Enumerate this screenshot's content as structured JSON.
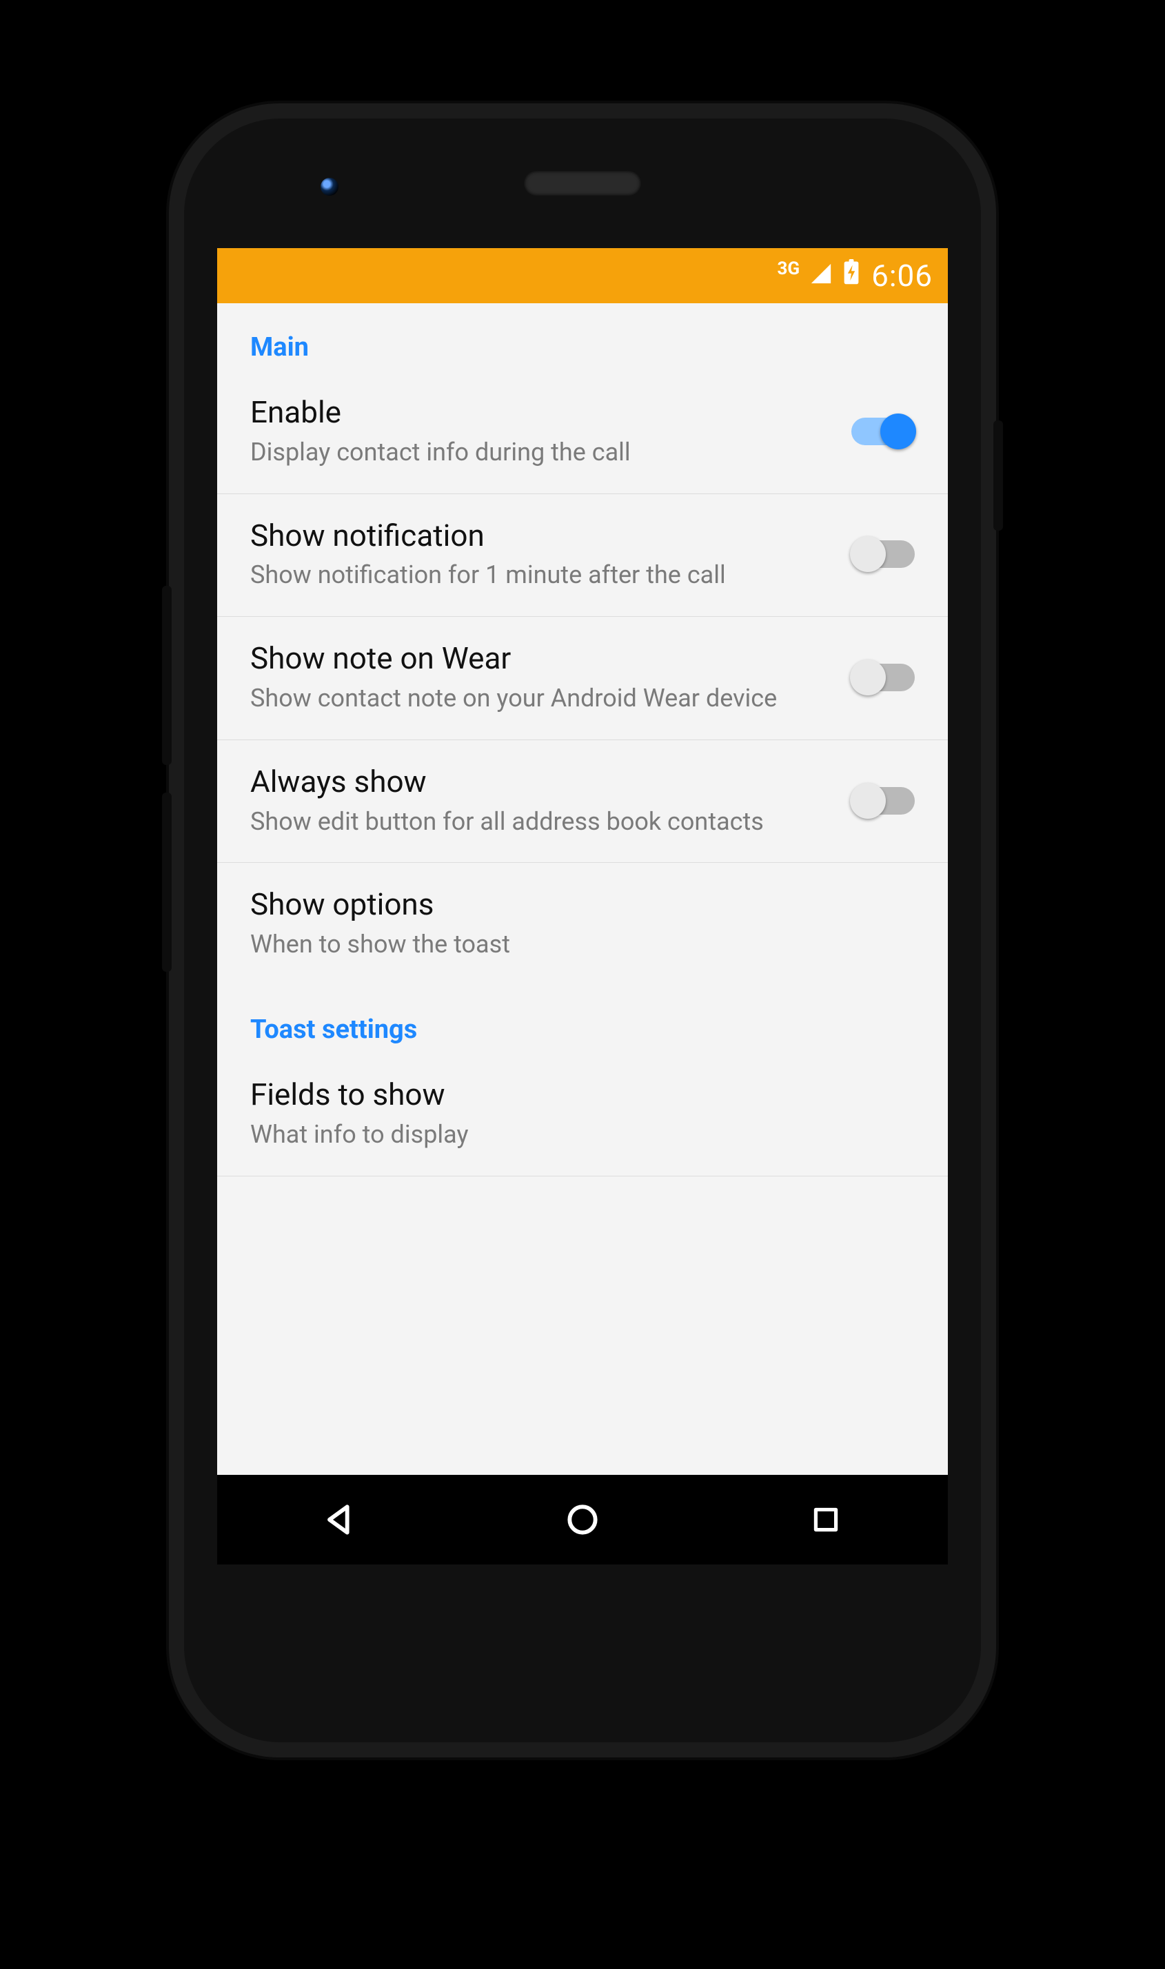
{
  "statusbar": {
    "network_label": "3G",
    "time": "6:06"
  },
  "sections": [
    {
      "header": "Main",
      "items": [
        {
          "title": "Enable",
          "subtitle": "Display contact info during the call",
          "switch": true,
          "on": true
        },
        {
          "title": "Show notification",
          "subtitle": "Show notification for 1 minute after the call",
          "switch": true,
          "on": false
        },
        {
          "title": "Show note on Wear",
          "subtitle": "Show contact note on your Android Wear device",
          "switch": true,
          "on": false
        },
        {
          "title": "Always show",
          "subtitle": "Show edit button for all address book contacts",
          "switch": true,
          "on": false
        },
        {
          "title": "Show options",
          "subtitle": "When to show the toast",
          "switch": false
        }
      ]
    },
    {
      "header": "Toast settings",
      "items": [
        {
          "title": "Fields to show",
          "subtitle": "What info to display",
          "switch": false
        }
      ]
    }
  ]
}
